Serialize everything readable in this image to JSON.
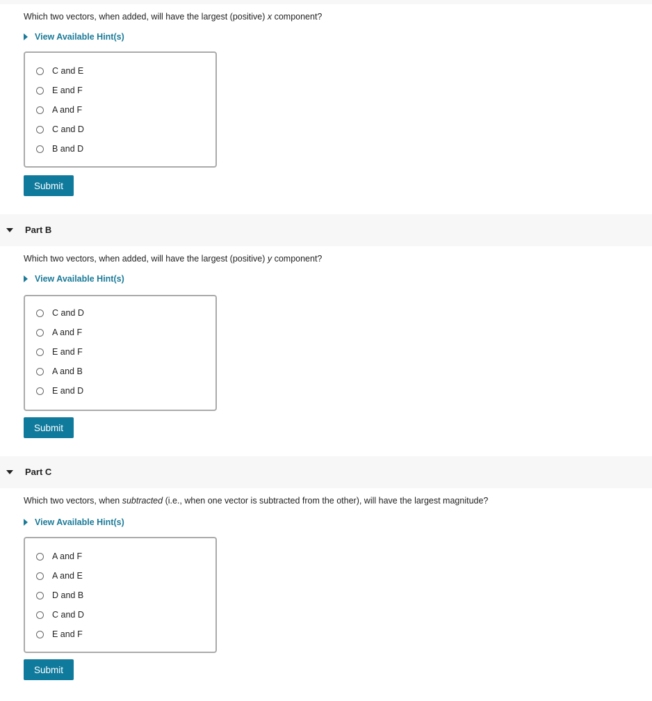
{
  "accent_color": "#0f7a9c",
  "link_color": "#1a7a98",
  "part_a": {
    "question_before": "Which two vectors, when added, will have the largest (positive) ",
    "question_var": "x",
    "question_after": " component?",
    "hint_label": "View Available Hint(s)",
    "options": [
      "C and E",
      "E and F",
      "A and F",
      "C and D",
      "B and D"
    ],
    "submit_label": "Submit"
  },
  "part_b": {
    "title": "Part B",
    "question_before": "Which two vectors, when added, will have the largest (positive) ",
    "question_var": "y",
    "question_after": " component?",
    "hint_label": "View Available Hint(s)",
    "options": [
      "C and D",
      "A and F",
      "E and F",
      "A and B",
      "E and D"
    ],
    "submit_label": "Submit"
  },
  "part_c": {
    "title": "Part C",
    "question_before": "Which two vectors, when ",
    "question_var": "subtracted",
    "question_after": " (i.e., when one vector is subtracted from the other), will have the largest magnitude?",
    "hint_label": "View Available Hint(s)",
    "options": [
      "A and F",
      "A and E",
      "D and B",
      "C and D",
      "E and F"
    ],
    "submit_label": "Submit"
  }
}
